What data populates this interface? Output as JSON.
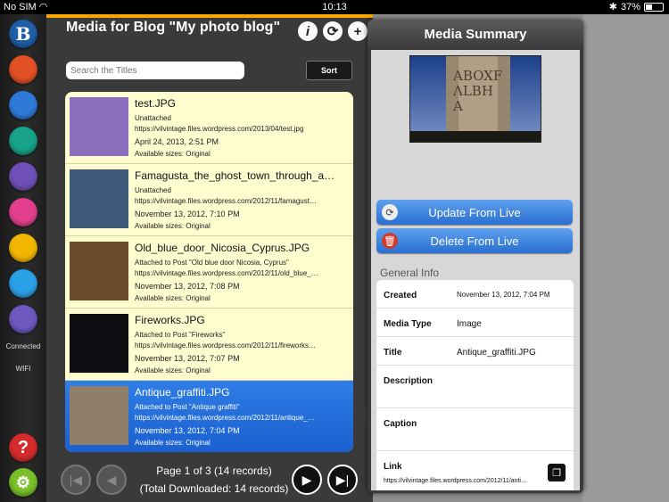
{
  "status_bar": {
    "carrier": "No SIM",
    "time": "10:13",
    "battery": "37%"
  },
  "sidebar": {
    "items": [
      {
        "name": "blog",
        "icon": "blog-b-icon",
        "glyph": "B",
        "color": "#1f5fa8"
      },
      {
        "name": "posts",
        "icon": "pin-icon",
        "glyph": "",
        "color": "#e25126"
      },
      {
        "name": "pages",
        "icon": "pages-icon",
        "glyph": "",
        "color": "#2f7ad8"
      },
      {
        "name": "tags",
        "icon": "tag-icon",
        "glyph": "",
        "color": "#17a289"
      },
      {
        "name": "categories",
        "icon": "tree-icon",
        "glyph": "",
        "color": "#6f4fb8"
      },
      {
        "name": "comments",
        "icon": "comment-icon",
        "glyph": "",
        "color": "#e2408f"
      },
      {
        "name": "media",
        "icon": "camera-icon",
        "glyph": "",
        "color": "#f2b700"
      },
      {
        "name": "stats",
        "icon": "stats-icon",
        "glyph": "",
        "color": "#2aa0e6"
      },
      {
        "name": "reader",
        "icon": "book-icon",
        "glyph": "",
        "color": "#6d59c0"
      }
    ],
    "connection_status": "Connected",
    "network": "WIFI",
    "help_glyph": "?",
    "help_color": "#d42c2c",
    "settings_color": "#7bbf2a"
  },
  "header": {
    "title": "Media for Blog \"My photo blog\"",
    "info_glyph": "i",
    "refresh_glyph": "⟳",
    "add_glyph": "+"
  },
  "search": {
    "placeholder": "Search the Titles"
  },
  "sort_label": "Sort",
  "media_list": [
    {
      "title": "test.JPG",
      "status": "Unattached",
      "url": "https://vilvintage.files.wordpress.com/2013/04/test.jpg",
      "date": "April 24, 2013, 2:51 PM",
      "sizes": "Available sizes: Original",
      "selected": false
    },
    {
      "title": "Famagusta_the_ghost_town_through_a…",
      "status": "Unattached",
      "url": "https://vilvintage.files.wordpress.com/2012/11/famagust…",
      "date": "November 13, 2012, 7:10 PM",
      "sizes": "Available sizes: Original",
      "selected": false
    },
    {
      "title": "Old_blue_door_Nicosia_Cyprus.JPG",
      "status": "Attached to Post \"Old blue door Nicosia, Cyprus\"",
      "url": "https://vilvintage.files.wordpress.com/2012/11/old_blue_…",
      "date": "November 13, 2012, 7:08 PM",
      "sizes": "Available sizes: Original",
      "selected": false
    },
    {
      "title": "Fireworks.JPG",
      "status": "Attached to Post \"Fireworks\"",
      "url": "https://vilvintage.files.wordpress.com/2012/11/fireworks…",
      "date": "November 13, 2012, 7:07 PM",
      "sizes": "Available sizes: Original",
      "selected": false
    },
    {
      "title": "Antique_graffiti.JPG",
      "status": "Attached to Post \"Antique graffiti\"",
      "url": "https://vilvintage.files.wordpress.com/2012/11/antique_…",
      "date": "November 13, 2012, 7:04 PM",
      "sizes": "Available sizes: Original",
      "selected": true
    }
  ],
  "pager": {
    "page_text": "Page 1 of 3 (14 records)",
    "downloaded_text": "(Total Downloaded: 14 records)",
    "first_glyph": "|◀",
    "prev_glyph": "◀",
    "next_glyph": "▶",
    "last_glyph": "▶|"
  },
  "summary": {
    "title": "Media Summary",
    "preview_text": "ABOXF\nΛLBH\nA",
    "update_label": "Update From Live",
    "delete_label": "Delete From Live",
    "section_label": "General Info",
    "fields": [
      {
        "label": "Created",
        "value": "November 13, 2012, 7:04 PM"
      },
      {
        "label": "Media Type",
        "value": "Image"
      },
      {
        "label": "Title",
        "value": "Antique_graffiti.JPG"
      },
      {
        "label": "Description",
        "value": ""
      },
      {
        "label": "Caption",
        "value": ""
      },
      {
        "label": "Link",
        "value": "https://vilvintage.files.wordpress.com/2012/11/anti…"
      }
    ]
  }
}
